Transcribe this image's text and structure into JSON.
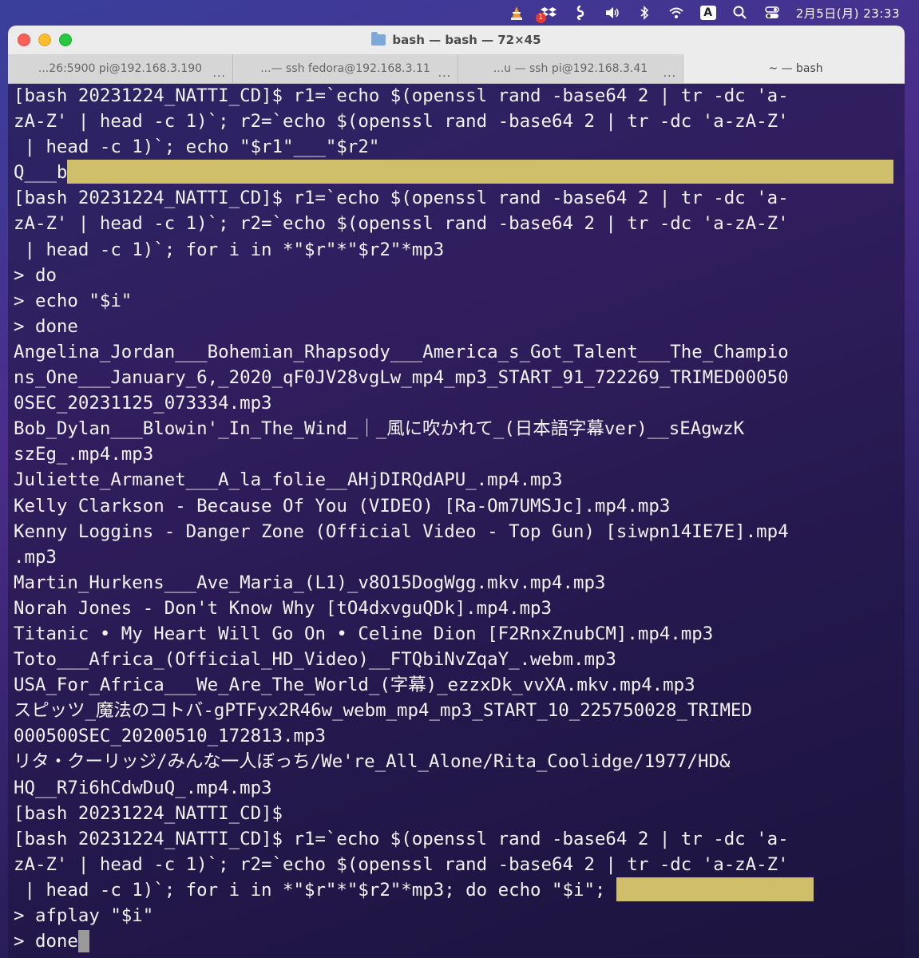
{
  "menubar": {
    "icons": [
      "vlc-icon",
      "dropbox-icon",
      "script-icon",
      "volume-icon",
      "bluetooth-icon",
      "wifi-icon",
      "input-method-icon",
      "search-icon",
      "control-center-icon"
    ],
    "dropbox_badge": "1",
    "input_letter": "A",
    "clock": "2月5日(月) 23:33"
  },
  "window": {
    "title": "bash — bash — 72×45"
  },
  "tabs": [
    {
      "label": "...26:5900 pi@192.168.3.190",
      "more": "..."
    },
    {
      "label": "...— ssh fedora@192.168.3.11",
      "more": "..."
    },
    {
      "label": "...u — ssh pi@192.168.3.41",
      "more": "..."
    },
    {
      "label": "~ — bash",
      "more": ""
    }
  ],
  "tab_add": "+",
  "terminal": {
    "lines": [
      "[bash 20231224_NATTI_CD]$ r1=`echo $(openssl rand -base64 2 | tr -dc 'a-",
      "zA-Z' | head -c 1)`; r2=`echo $(openssl rand -base64 2 | tr -dc 'a-zA-Z'",
      " | head -c 1)`; echo \"$r1\"___\"$r2\"",
      "Q___b",
      "[bash 20231224_NATTI_CD]$ r1=`echo $(openssl rand -base64 2 | tr -dc 'a-",
      "zA-Z' | head -c 1)`; r2=`echo $(openssl rand -base64 2 | tr -dc 'a-zA-Z'",
      " | head -c 1)`; for i in *\"$r\"*\"$r2\"*mp3",
      "> do",
      "> echo \"$i\"",
      "> done",
      "Angelina_Jordan___Bohemian_Rhapsody___America_s_Got_Talent___The_Champio",
      "ns_One___January_6,_2020_qF0JV28vgLw_mp4_mp3_START_91_722269_TRIMED00050",
      "0SEC_20231125_073334.mp3",
      "Bob_Dylan___Blowin'_In_The_Wind_｜_風に吹かれて_(日本語字幕ver)__sEAgwzK",
      "szEg_.mp4.mp3",
      "Juliette_Armanet___A_la_folie__AHjDIRQdAPU_.mp4.mp3",
      "Kelly Clarkson - Because Of You (VIDEO) [Ra-Om7UMSJc].mp4.mp3",
      "Kenny Loggins - Danger Zone (Official Video - Top Gun) [siwpn14IE7E].mp4",
      ".mp3",
      "Martin_Hurkens___Ave_Maria_(L1)_v8O15DogWgg.mkv.mp4.mp3",
      "Norah Jones - Don't Know Why [tO4dxvguQDk].mp4.mp3",
      "Titanic • My Heart Will Go On • Celine Dion [F2RnxZnubCM].mp4.mp3",
      "Toto___Africa_(Official_HD_Video)__FTQbiNvZqaY_.webm.mp3",
      "USA_For_Africa___We_Are_The_World_(字幕)_ezzxDk_vvXA.mkv.mp4.mp3",
      "スピッツ_魔法のコトバ-gPTFyx2R46w_webm_mp4_mp3_START_10_225750028_TRIMED",
      "000500SEC_20200510_172813.mp3",
      "リタ・クーリッジ/みんな一人ぼっち/We're_All_Alone/Rita_Coolidge/1977/HD&",
      "HQ__R7i6hCdwDuQ_.mp4.mp3",
      "[bash 20231224_NATTI_CD]$",
      "[bash 20231224_NATTI_CD]$ r1=`echo $(openssl rand -base64 2 | tr -dc 'a-",
      "zA-Z' | head -c 1)`; r2=`echo $(openssl rand -base64 2 | tr -dc 'a-zA-Z'",
      " | head -c 1)`; for i in *\"$r\"*\"$r2\"*mp3; do echo \"$i\"; ",
      "> afplay \"$i\"",
      "> done"
    ]
  }
}
